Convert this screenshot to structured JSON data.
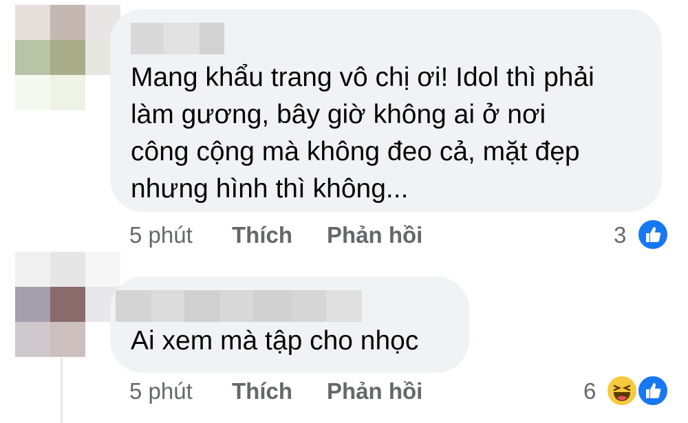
{
  "comments": [
    {
      "text_lines": [
        "Mang khẩu trang vô chị ơi! Idol thì phải",
        "làm gương, bây giờ không ai ở nơi",
        "công cộng mà không đeo cả, mặt đẹp",
        "nhưng hình thì không..."
      ],
      "time": "5 phút",
      "like_label": "Thích",
      "reply_label": "Phản hồi",
      "reaction_count": "3",
      "reactions": [
        "like-icon"
      ]
    },
    {
      "text_lines": [
        "Ai xem mà tập cho nhọc"
      ],
      "time": "5 phút",
      "like_label": "Thích",
      "reply_label": "Phản hồi",
      "reaction_count": "6",
      "reactions": [
        "haha-icon",
        "like-icon"
      ]
    }
  ],
  "colors": {
    "bubble_bg": "#f0f2f5",
    "secondary_text": "#65676b",
    "like_blue": "#1877f2",
    "haha_yellow": "#f7c940"
  }
}
